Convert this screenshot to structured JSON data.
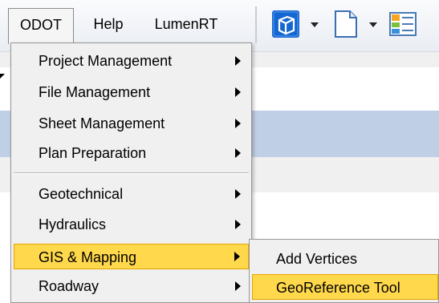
{
  "menubar": {
    "items": [
      {
        "label": "ODOT"
      },
      {
        "label": "Help"
      },
      {
        "label": "LumenRT"
      }
    ]
  },
  "toolbar": {
    "icons": [
      "cube-view-icon",
      "document-icon",
      "grid-chart-icon"
    ]
  },
  "dropdown": {
    "items": [
      {
        "label": "Project Management"
      },
      {
        "label": "File Management"
      },
      {
        "label": "Sheet Management"
      },
      {
        "label": "Plan Preparation"
      },
      {
        "label": "Geotechnical"
      },
      {
        "label": "Hydraulics"
      },
      {
        "label": "GIS & Mapping"
      },
      {
        "label": "Roadway"
      }
    ]
  },
  "submenu": {
    "items": [
      {
        "label": "Add Vertices"
      },
      {
        "label": "GeoReference Tool"
      }
    ]
  },
  "colors": {
    "highlight": "#ffd84b",
    "highlight_border": "#e5a400",
    "toolbar_blue": "#1466d1"
  }
}
